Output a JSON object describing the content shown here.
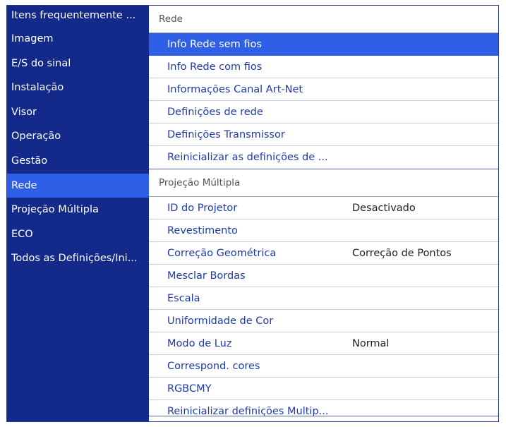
{
  "sidebar": {
    "items": [
      {
        "label": "Itens frequentemente ..."
      },
      {
        "label": "Imagem"
      },
      {
        "label": "E/S do sinal"
      },
      {
        "label": "Instalação"
      },
      {
        "label": "Visor"
      },
      {
        "label": "Operação"
      },
      {
        "label": "Gestão"
      },
      {
        "label": "Rede",
        "active": true
      },
      {
        "label": "Projeção Múltipla"
      },
      {
        "label": "ECO"
      },
      {
        "label": "Todos as Definições/Ini..."
      }
    ]
  },
  "network_section": {
    "title": "Rede",
    "items": [
      {
        "label": "Info Rede sem fios",
        "selected": true
      },
      {
        "label": "Info Rede com fios"
      },
      {
        "label": "Informações Canal Art-Net"
      },
      {
        "label": "Definições de rede"
      },
      {
        "label": "Definições Transmissor"
      },
      {
        "label": "Reinicializar as definições de ..."
      }
    ]
  },
  "multi_projection_section": {
    "title": "Projeção Múltipla",
    "items": [
      {
        "label": "ID do Projetor",
        "value": "Desactivado"
      },
      {
        "label": "Revestimento",
        "value": ""
      },
      {
        "label": "Correção Geométrica",
        "value": "Correção de Pontos"
      },
      {
        "label": "Mesclar Bordas",
        "value": ""
      },
      {
        "label": "Escala",
        "value": ""
      },
      {
        "label": "Uniformidade de Cor",
        "value": ""
      },
      {
        "label": "Modo de Luz",
        "value": "Normal"
      },
      {
        "label": "Correspond. cores",
        "value": ""
      },
      {
        "label": "RGBCMY",
        "value": ""
      },
      {
        "label": "Reinicializar definições Multip...",
        "value": ""
      }
    ]
  },
  "colors": {
    "sidebar_bg": "#142a8a",
    "highlight": "#2f5fe6",
    "menu_text": "#1e3aa5"
  }
}
